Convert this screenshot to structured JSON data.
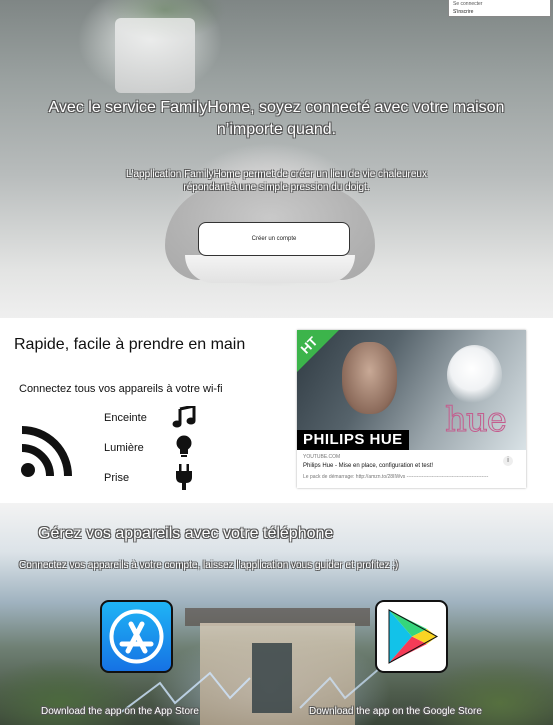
{
  "auth_menu": {
    "login": "Se connecter",
    "signup": "S'inscrire"
  },
  "hero": {
    "title": "Avec le service FamilyHome, soyez connecté avec votre maison n’importe quand.",
    "text": "L'application FamilyHome permet de créer un lieu de vie chaleureux répondant à une simple pression du doigt.",
    "cta": "Créer un compte"
  },
  "features": {
    "title": "Rapide, facile à prendre en main",
    "subtitle": "Connectez tous vos appareils à votre wi-fi",
    "devices": [
      {
        "label": "Enceinte",
        "icon": "music-note-icon"
      },
      {
        "label": "Lumière",
        "icon": "lightbulb-icon"
      },
      {
        "label": "Prise",
        "icon": "power-plug-icon"
      }
    ],
    "video": {
      "badge": "HT",
      "brand": "PHILIPS HUE",
      "logo": "hue",
      "source": "YOUTUBE.COM",
      "title": "Philips Hue - Mise en place, configuration et test!",
      "description": "Le pack de démarrage: http://amzn.to/28IlWvs -------------------------------------------------"
    }
  },
  "apps": {
    "title": "Gérez vos appareils avec votre téléphone",
    "subtitle": "Connectez vos appareils à votre compte, laissez l'application vous guider et profitez ;)",
    "app_store_label": "Download the app on the App Store",
    "google_store_label": "Download the app on the Google Store"
  },
  "colors": {
    "accent_green": "#3cb44b",
    "app_store_blue": "#1a8df0"
  }
}
